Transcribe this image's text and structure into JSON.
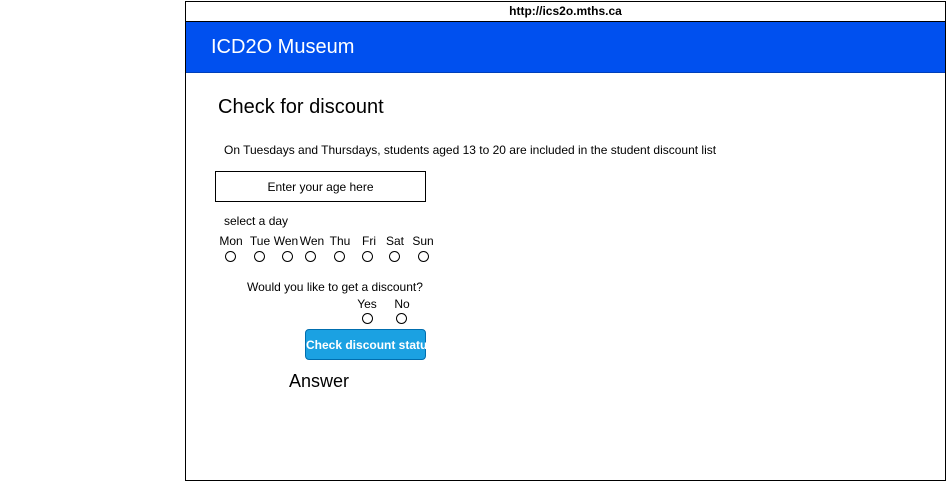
{
  "browser": {
    "url": "http://ics2o.mths.ca"
  },
  "header": {
    "title": "ICD2O Museum"
  },
  "main": {
    "title": "Check for discount",
    "info": "On Tuesdays and Thursdays, students aged 13 to 20 are included in the student discount list",
    "age_input": {
      "placeholder": "Enter your age here",
      "value": ""
    },
    "day_label": "select a day",
    "days": [
      "Mon",
      "Tue",
      "Wen",
      "Wen",
      "Thu",
      "Fri",
      "Sat",
      "Sun"
    ],
    "discount_question": "Would you like to get a discount?",
    "discount_options": [
      "Yes",
      "No"
    ],
    "check_button_label": "Check discount status",
    "answer": "Answer"
  },
  "colors": {
    "header_bg": "#0050ef",
    "button_bg": "#1ba1e2"
  }
}
